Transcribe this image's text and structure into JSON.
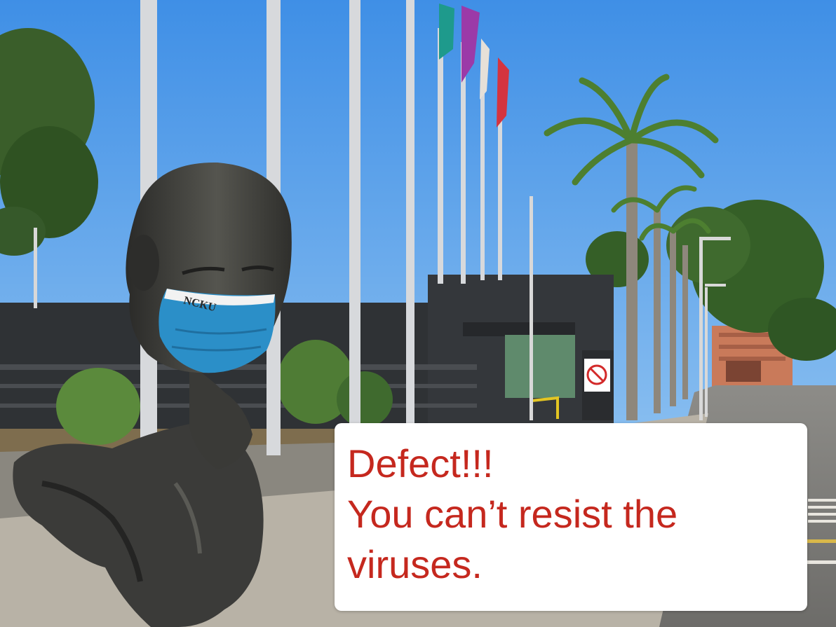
{
  "caption": {
    "lines": [
      "Defect!!!",
      "You can’t resist the",
      "viruses."
    ],
    "color": "#c5281e"
  },
  "mask_print": "NCKU",
  "flags": [
    {
      "color": "#1e9a8c"
    },
    {
      "color": "#9b3aa8"
    },
    {
      "color": "#e6e0d8"
    },
    {
      "color": "#d4343f"
    }
  ],
  "colors": {
    "sky": "#77b7ef",
    "mask": "#2b8fc8",
    "statue": "#3b3b39",
    "wall": "#2f3235",
    "foliage": "#3f6a2e",
    "pavement": "#b8b2a6"
  }
}
